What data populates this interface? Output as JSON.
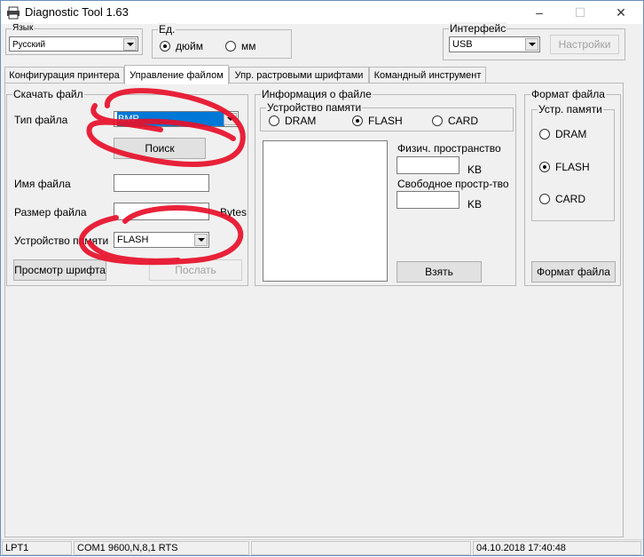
{
  "window": {
    "title": "Diagnostic Tool 1.63",
    "controls": {
      "minimize": "–",
      "maximize": "☐",
      "close": "✕"
    }
  },
  "language": {
    "label": "Язык",
    "value": "Русский"
  },
  "units": {
    "label": "Ед.",
    "options": [
      "дюйм",
      "мм"
    ],
    "selected": "дюйм"
  },
  "interface": {
    "label": "Интерфейс",
    "value": "USB",
    "settings_button": "Настройки"
  },
  "tabs": [
    {
      "label": "Конфигурация принтера",
      "active": false
    },
    {
      "label": "Управление файлом",
      "active": true
    },
    {
      "label": "Упр. растровыми шрифтами",
      "active": false
    },
    {
      "label": "Командный инструмент",
      "active": false
    }
  ],
  "download": {
    "legend": "Скачать файл",
    "file_type_label": "Тип файла",
    "file_type_value": "BMP",
    "search_button": "Поиск",
    "file_name_label": "Имя файла",
    "file_name_value": "",
    "file_size_label": "Размер файла",
    "file_size_value": "",
    "bytes_unit": "Bytes",
    "memory_device_label": "Устройство памяти",
    "memory_device_value": "FLASH",
    "preview_font_button": "Просмотр шрифта",
    "send_button": "Послать"
  },
  "file_info": {
    "legend": "Информация о файле",
    "memory_legend": "Устройство памяти",
    "memory_options": [
      "DRAM",
      "FLASH",
      "CARD"
    ],
    "memory_selected": "FLASH",
    "physical_space_label": "Физич. пространство",
    "physical_space_unit": "KB",
    "free_space_label": "Свободное простр-тво",
    "free_space_unit": "KB",
    "take_button": "Взять"
  },
  "file_format": {
    "legend": "Формат файла",
    "memory_legend": "Устр. памяти",
    "memory_options": [
      "DRAM",
      "FLASH",
      "CARD"
    ],
    "memory_selected": "FLASH",
    "format_button": "Формат файла"
  },
  "status_bar": {
    "port": "LPT1",
    "com_settings": "COM1 9600,N,8,1 RTS",
    "message": "",
    "datetime": "04.10.2018 17:40:48"
  },
  "annotation_color": "#e8102a"
}
